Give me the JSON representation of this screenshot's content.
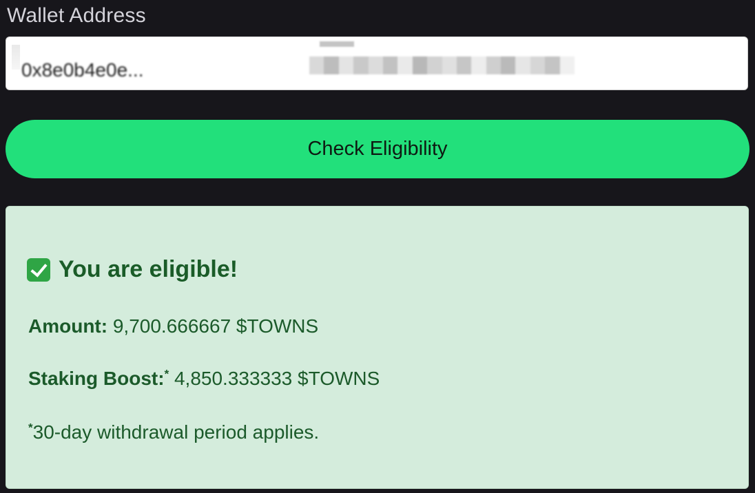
{
  "wallet": {
    "label": "Wallet Address",
    "value": "0x8e0b4e0e..."
  },
  "check_button": {
    "label": "Check Eligibility"
  },
  "result": {
    "heading": "You are eligible!",
    "icon": "checkmark-icon",
    "amount_label": "Amount:",
    "amount_value": "9,700.666667 $TOWNS",
    "boost_label": "Staking Boost:",
    "boost_marker": "*",
    "boost_value": "4,850.333333 $TOWNS",
    "note_marker": "*",
    "note_text": "30-day withdrawal period applies."
  },
  "colors": {
    "background": "#17161b",
    "accent_button": "#22e07b",
    "result_bg": "#d4ecdc",
    "result_text": "#1b5a2a"
  }
}
